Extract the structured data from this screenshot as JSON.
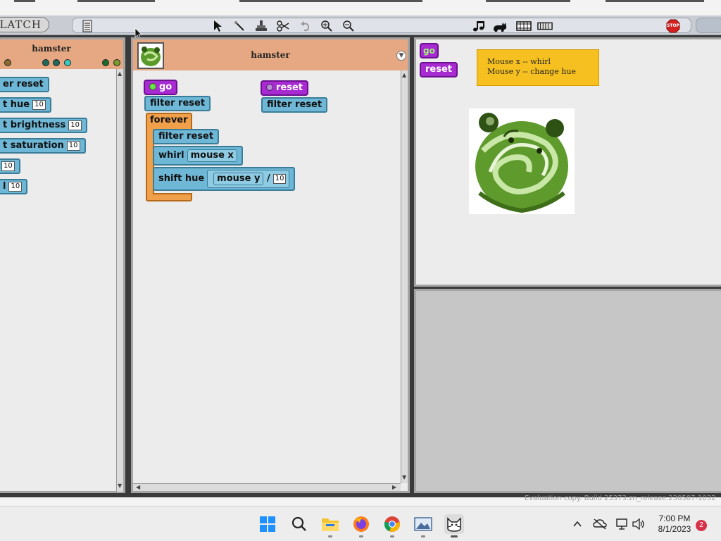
{
  "menubar": {
    "logo": "LATCH",
    "stop_label": "STOP"
  },
  "palette": {
    "title": "hamster",
    "blocks": [
      {
        "label": "er reset"
      },
      {
        "label": "t hue",
        "value": "10"
      },
      {
        "label": "t brightness",
        "value": "10"
      },
      {
        "label": "t saturation",
        "value": "10"
      },
      {
        "label": "",
        "value": "10"
      },
      {
        "label": "l",
        "value": "10"
      }
    ]
  },
  "editor": {
    "sprite_name": "hamster",
    "scripts": {
      "go_hat": "go",
      "filter_reset": "filter reset",
      "forever": "forever",
      "inner_filter_reset": "filter reset",
      "whirl": "whirl",
      "mouse_x": "mouse x",
      "shift_hue": "shift hue",
      "mouse_y": "mouse y",
      "divide_op": "/",
      "divide_value": "10",
      "reset_hat": "reset",
      "reset_filter": "filter reset"
    }
  },
  "stage": {
    "go_button": "go",
    "reset_button": "reset",
    "note_line1": "Mouse x -- whirl",
    "note_line2": "Mouse y -- change hue"
  },
  "watermark": "Evaluation copy. Build 25373.zn_release.230507-1032",
  "taskbar": {
    "time": "7:00 PM",
    "date": "8/1/2023",
    "notifications": "2"
  },
  "colors": {
    "block_blue": "#6eb7d6",
    "hat_purple": "#a82bd1",
    "control_orange": "#f0a04a",
    "sprite_header": "#e5a883",
    "note_yellow": "#f6c020"
  }
}
